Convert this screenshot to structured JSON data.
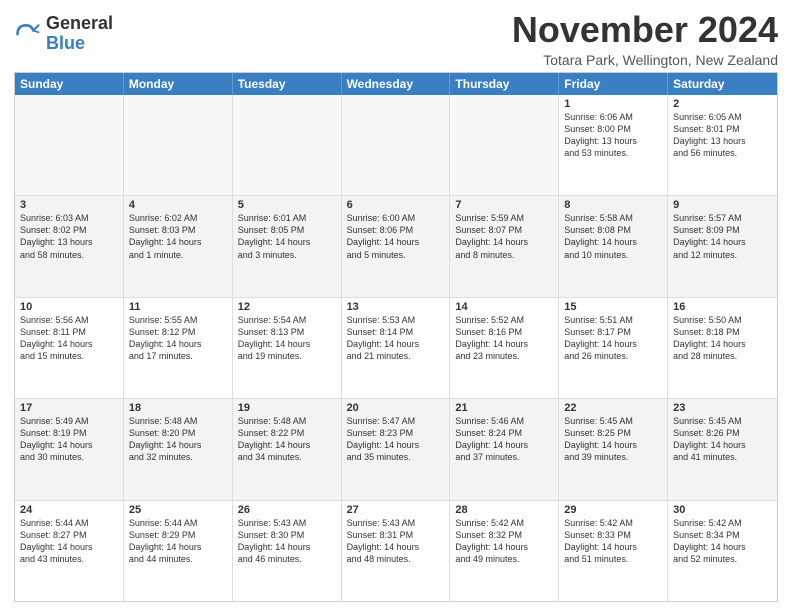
{
  "header": {
    "logo_general": "General",
    "logo_blue": "Blue",
    "month_title": "November 2024",
    "location": "Totara Park, Wellington, New Zealand"
  },
  "days_of_week": [
    "Sunday",
    "Monday",
    "Tuesday",
    "Wednesday",
    "Thursday",
    "Friday",
    "Saturday"
  ],
  "rows": [
    [
      {
        "day": "",
        "empty": true
      },
      {
        "day": "",
        "empty": true
      },
      {
        "day": "",
        "empty": true
      },
      {
        "day": "",
        "empty": true
      },
      {
        "day": "",
        "empty": true
      },
      {
        "day": "1",
        "lines": [
          "Sunrise: 6:06 AM",
          "Sunset: 8:00 PM",
          "Daylight: 13 hours",
          "and 53 minutes."
        ]
      },
      {
        "day": "2",
        "lines": [
          "Sunrise: 6:05 AM",
          "Sunset: 8:01 PM",
          "Daylight: 13 hours",
          "and 56 minutes."
        ]
      }
    ],
    [
      {
        "day": "3",
        "lines": [
          "Sunrise: 6:03 AM",
          "Sunset: 8:02 PM",
          "Daylight: 13 hours",
          "and 58 minutes."
        ]
      },
      {
        "day": "4",
        "lines": [
          "Sunrise: 6:02 AM",
          "Sunset: 8:03 PM",
          "Daylight: 14 hours",
          "and 1 minute."
        ]
      },
      {
        "day": "5",
        "lines": [
          "Sunrise: 6:01 AM",
          "Sunset: 8:05 PM",
          "Daylight: 14 hours",
          "and 3 minutes."
        ]
      },
      {
        "day": "6",
        "lines": [
          "Sunrise: 6:00 AM",
          "Sunset: 8:06 PM",
          "Daylight: 14 hours",
          "and 5 minutes."
        ]
      },
      {
        "day": "7",
        "lines": [
          "Sunrise: 5:59 AM",
          "Sunset: 8:07 PM",
          "Daylight: 14 hours",
          "and 8 minutes."
        ]
      },
      {
        "day": "8",
        "lines": [
          "Sunrise: 5:58 AM",
          "Sunset: 8:08 PM",
          "Daylight: 14 hours",
          "and 10 minutes."
        ]
      },
      {
        "day": "9",
        "lines": [
          "Sunrise: 5:57 AM",
          "Sunset: 8:09 PM",
          "Daylight: 14 hours",
          "and 12 minutes."
        ]
      }
    ],
    [
      {
        "day": "10",
        "lines": [
          "Sunrise: 5:56 AM",
          "Sunset: 8:11 PM",
          "Daylight: 14 hours",
          "and 15 minutes."
        ]
      },
      {
        "day": "11",
        "lines": [
          "Sunrise: 5:55 AM",
          "Sunset: 8:12 PM",
          "Daylight: 14 hours",
          "and 17 minutes."
        ]
      },
      {
        "day": "12",
        "lines": [
          "Sunrise: 5:54 AM",
          "Sunset: 8:13 PM",
          "Daylight: 14 hours",
          "and 19 minutes."
        ]
      },
      {
        "day": "13",
        "lines": [
          "Sunrise: 5:53 AM",
          "Sunset: 8:14 PM",
          "Daylight: 14 hours",
          "and 21 minutes."
        ]
      },
      {
        "day": "14",
        "lines": [
          "Sunrise: 5:52 AM",
          "Sunset: 8:16 PM",
          "Daylight: 14 hours",
          "and 23 minutes."
        ]
      },
      {
        "day": "15",
        "lines": [
          "Sunrise: 5:51 AM",
          "Sunset: 8:17 PM",
          "Daylight: 14 hours",
          "and 26 minutes."
        ]
      },
      {
        "day": "16",
        "lines": [
          "Sunrise: 5:50 AM",
          "Sunset: 8:18 PM",
          "Daylight: 14 hours",
          "and 28 minutes."
        ]
      }
    ],
    [
      {
        "day": "17",
        "lines": [
          "Sunrise: 5:49 AM",
          "Sunset: 8:19 PM",
          "Daylight: 14 hours",
          "and 30 minutes."
        ]
      },
      {
        "day": "18",
        "lines": [
          "Sunrise: 5:48 AM",
          "Sunset: 8:20 PM",
          "Daylight: 14 hours",
          "and 32 minutes."
        ]
      },
      {
        "day": "19",
        "lines": [
          "Sunrise: 5:48 AM",
          "Sunset: 8:22 PM",
          "Daylight: 14 hours",
          "and 34 minutes."
        ]
      },
      {
        "day": "20",
        "lines": [
          "Sunrise: 5:47 AM",
          "Sunset: 8:23 PM",
          "Daylight: 14 hours",
          "and 35 minutes."
        ]
      },
      {
        "day": "21",
        "lines": [
          "Sunrise: 5:46 AM",
          "Sunset: 8:24 PM",
          "Daylight: 14 hours",
          "and 37 minutes."
        ]
      },
      {
        "day": "22",
        "lines": [
          "Sunrise: 5:45 AM",
          "Sunset: 8:25 PM",
          "Daylight: 14 hours",
          "and 39 minutes."
        ]
      },
      {
        "day": "23",
        "lines": [
          "Sunrise: 5:45 AM",
          "Sunset: 8:26 PM",
          "Daylight: 14 hours",
          "and 41 minutes."
        ]
      }
    ],
    [
      {
        "day": "24",
        "lines": [
          "Sunrise: 5:44 AM",
          "Sunset: 8:27 PM",
          "Daylight: 14 hours",
          "and 43 minutes."
        ]
      },
      {
        "day": "25",
        "lines": [
          "Sunrise: 5:44 AM",
          "Sunset: 8:29 PM",
          "Daylight: 14 hours",
          "and 44 minutes."
        ]
      },
      {
        "day": "26",
        "lines": [
          "Sunrise: 5:43 AM",
          "Sunset: 8:30 PM",
          "Daylight: 14 hours",
          "and 46 minutes."
        ]
      },
      {
        "day": "27",
        "lines": [
          "Sunrise: 5:43 AM",
          "Sunset: 8:31 PM",
          "Daylight: 14 hours",
          "and 48 minutes."
        ]
      },
      {
        "day": "28",
        "lines": [
          "Sunrise: 5:42 AM",
          "Sunset: 8:32 PM",
          "Daylight: 14 hours",
          "and 49 minutes."
        ]
      },
      {
        "day": "29",
        "lines": [
          "Sunrise: 5:42 AM",
          "Sunset: 8:33 PM",
          "Daylight: 14 hours",
          "and 51 minutes."
        ]
      },
      {
        "day": "30",
        "lines": [
          "Sunrise: 5:42 AM",
          "Sunset: 8:34 PM",
          "Daylight: 14 hours",
          "and 52 minutes."
        ]
      }
    ]
  ]
}
